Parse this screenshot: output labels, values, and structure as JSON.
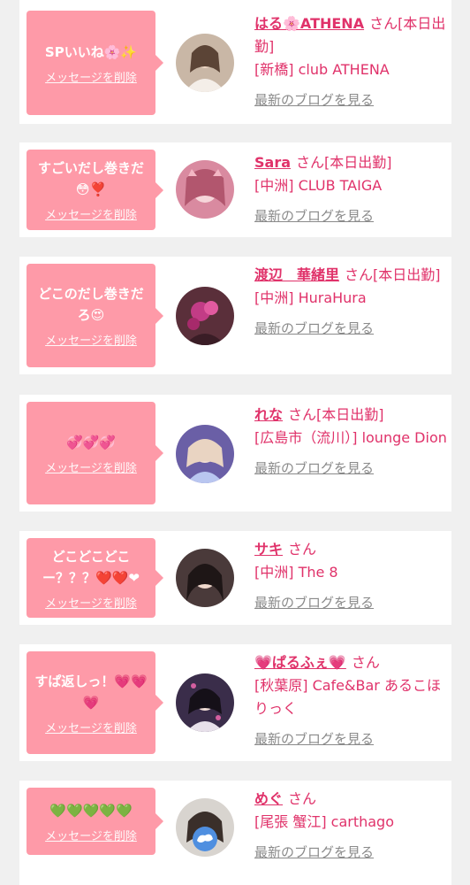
{
  "list": {
    "items": [
      {
        "message": "SPいいね🌸✨",
        "delete_label": "メッセージを削除",
        "name": "はる🌸ATHENA",
        "honorific": "さん",
        "status": "[本日出勤]",
        "shop": "[新橋] club ATHENA",
        "blog_link": "最新のブログを見る",
        "avatar_color": "#c9b7a6"
      },
      {
        "message": "すごいだし巻きだ😳❣️",
        "delete_label": "メッセージを削除",
        "name": "Sara",
        "honorific": "さん",
        "status": "[本日出勤]",
        "shop": "[中洲] CLUB TAIGA",
        "blog_link": "最新のブログを見る",
        "avatar_color": "#d98aa0"
      },
      {
        "message": "どこのだし巻きだろ😍",
        "delete_label": "メッセージを削除",
        "name": "渡辺　華緒里",
        "honorific": "さん",
        "status": "[本日出勤]",
        "shop": "[中洲] HuraHura",
        "blog_link": "最新のブログを見る",
        "avatar_color": "#5a2f3a"
      },
      {
        "message": "💞💞💞",
        "delete_label": "メッセージを削除",
        "name": "れな",
        "honorific": "さん",
        "status": "[本日出勤]",
        "shop": "[広島市（流川）] lounge Dion",
        "blog_link": "最新のブログを見る",
        "avatar_color": "#6a5fa6"
      },
      {
        "message": "どこどこどこー？？？❤️❤️❤",
        "delete_label": "メッセージを削除",
        "name": "サキ",
        "honorific": "さん",
        "status": "",
        "shop": "[中洲] The 8",
        "blog_link": "最新のブログを見る",
        "avatar_color": "#4a3a3a"
      },
      {
        "message": "すぱ返しっ！💗💗💗",
        "delete_label": "メッセージを削除",
        "name": "💗ぱるふぇ💗",
        "honorific": "さん",
        "status": "",
        "shop": "[秋葉原] Cafe&Bar あるこほりっく",
        "blog_link": "最新のブログを見る",
        "avatar_color": "#3a2d4a"
      },
      {
        "message": "💚💚💚💚💚",
        "delete_label": "メッセージを削除",
        "name": "めぐ",
        "honorific": "さん",
        "status": "",
        "shop": "[尾張 蟹江] carthago",
        "blog_link": "最新のブログを見る",
        "avatar_color": "#d8d4cf"
      }
    ]
  }
}
